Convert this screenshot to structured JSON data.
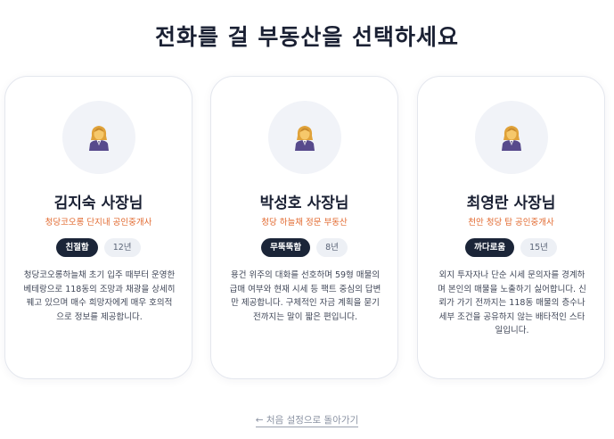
{
  "page": {
    "title": "전화를 걸 부동산을 선택하세요"
  },
  "agents": [
    {
      "name": "김지숙 사장님",
      "office": "청당코오롱 단지내 공인중개사",
      "style": "친절함",
      "years": "12년",
      "description": "청당코오롱하늘채 초기 입주 때부터 운영한 베테랑으로 118동의 조망과 채광을 상세히 꿰고 있으며 매수 희망자에게 매우 호의적으로 정보를 제공합니다."
    },
    {
      "name": "박성호 사장님",
      "office": "청당 하늘채 정문 부동산",
      "style": "무뚝뚝함",
      "years": "8년",
      "description": "용건 위주의 대화를 선호하며 59형 매물의 급매 여부와 현재 시세 등 팩트 중심의 답변만 제공합니다. 구체적인 자금 계획을 묻기 전까지는 말이 짧은 편입니다."
    },
    {
      "name": "최영란 사장님",
      "office": "천안 청당 탑 공인중개사",
      "style": "까다로움",
      "years": "15년",
      "description": "외지 투자자나 단순 시세 문의자를 경계하며 본인의 매물을 노출하기 싫어합니다. 신뢰가 가기 전까지는 118동 매물의 층수나 세부 조건을 공유하지 않는 배타적인 스타일입니다."
    }
  ],
  "footer": {
    "back_label": "← 처음 설정으로 돌아가기"
  },
  "icons": {
    "avatar": "office-worker-woman-icon"
  },
  "colors": {
    "accent_orange": "#e2692f",
    "badge_dark": "#1b2538",
    "badge_light": "#edf0f5"
  }
}
